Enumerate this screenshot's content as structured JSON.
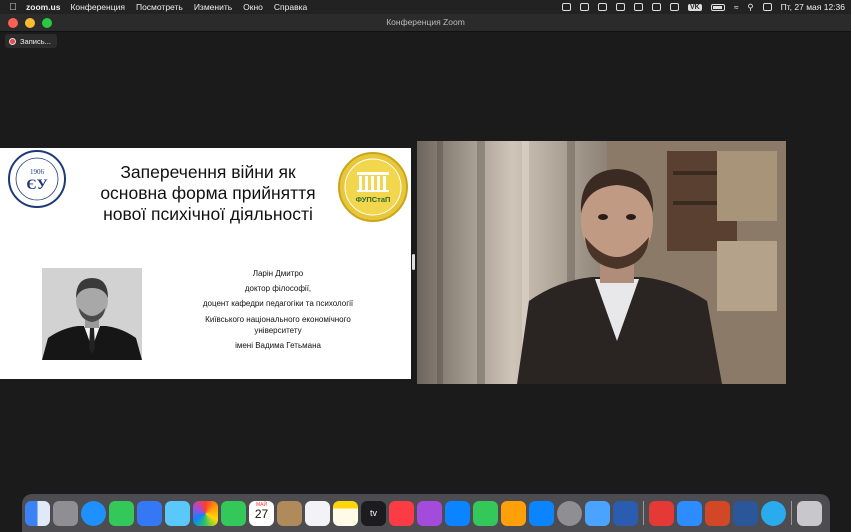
{
  "menubar": {
    "app_name": "zoom.us",
    "items": [
      "Конференция",
      "Посмотреть",
      "Изменить",
      "Окно",
      "Справка"
    ],
    "vk_label": "VK",
    "datetime": "Пт, 27 мая  12:36"
  },
  "window": {
    "title": "Конференция Zoom"
  },
  "recording": {
    "label": "Запись..."
  },
  "slide": {
    "title_lines": [
      "Заперечення війни як",
      "основна форма прийняття",
      "нової психічної діяльності"
    ],
    "logo_left_year": "1906",
    "logo_right_text": "ФУПСтаП",
    "author_lines": [
      "Ларін Дмитро",
      "доктор філософії,",
      "доцент кафедри педагогіки та психології",
      "Київського національного економічного",
      "університету",
      "імені Вадима Гетьмана"
    ]
  },
  "dock": {
    "calendar_day": "27",
    "calendar_month": "МАЙ",
    "tv_label": "tv",
    "colors": [
      "#3b82f6",
      "#8e8e93",
      "#1e90ff",
      "#34c759",
      "#3478f6",
      "#5ac8fa",
      "#ff9f0a",
      "#34c759",
      "#ff3b30",
      "#b08a5a",
      "#f2f2f7",
      "#ffd60a",
      "#1c1c1e",
      "#fc3c44",
      "#a34bdb",
      "#0a84ff",
      "#ffcc00",
      "#ff9f0a",
      "#0a84ff",
      "#8e8e93",
      "#4aa3ff",
      "#2a5db0",
      "#e53935",
      "#d24726",
      "#2b579a",
      "#2aabee",
      "#c7c7cc"
    ]
  }
}
